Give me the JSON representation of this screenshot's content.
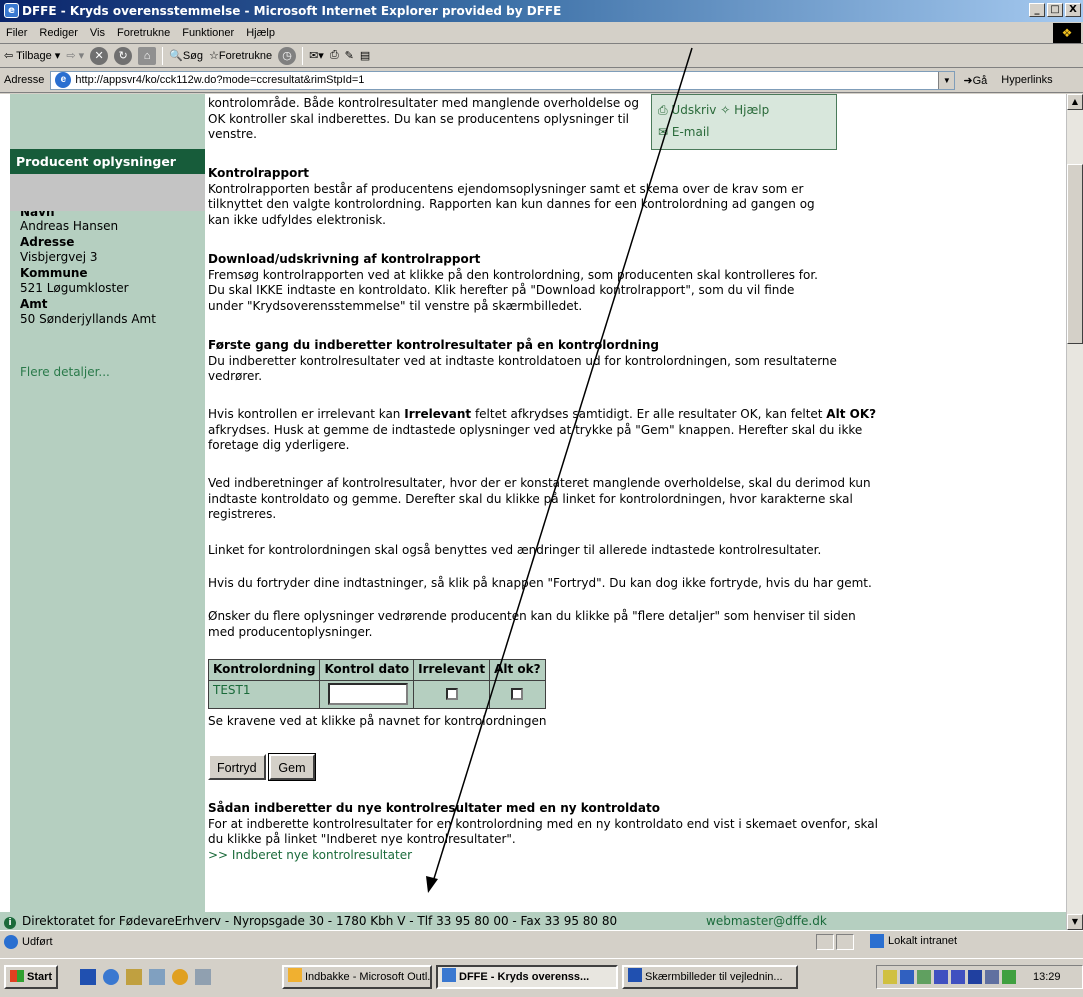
{
  "window": {
    "title": "DFFE - Kryds overensstemmelse - Microsoft Internet Explorer provided by DFFE",
    "controls": [
      "_",
      "□",
      "X"
    ]
  },
  "menubar": {
    "items": [
      "Filer",
      "Rediger",
      "Vis",
      "Foretrukne",
      "Funktioner",
      "Hjælp"
    ]
  },
  "toolbar": {
    "back_label": "Tilbage",
    "search_label": "Søg",
    "favorites_label": "Foretrukne"
  },
  "addressbar": {
    "label": "Adresse",
    "url": "http://appsvr4/ko/cck112w.do?mode=ccresultat&rimStpId=1",
    "go_label": "Gå",
    "links_label": "Hyperlinks"
  },
  "left_panel": {
    "header": "Producent oplysninger",
    "fields": [
      {
        "label": "Navn",
        "value": "Andreas Hansen"
      },
      {
        "label": "Adresse",
        "value": "Visbjergvej 3"
      },
      {
        "label": "Kommune",
        "value": "521 Løgumkloster"
      },
      {
        "label": "Amt",
        "value": "50 Sønderjyllands Amt"
      }
    ],
    "more_link": "Flere detaljer..."
  },
  "topbox": {
    "print_label": "Udskriv",
    "help_label": "Hjælp",
    "email_label": "E-mail"
  },
  "content": {
    "intro_lines": [
      "kontrolområde. Både kontrolresultater med manglende overholdelse og",
      "OK kontroller skal indberettes. Du kan se producentens oplysninger til",
      "venstre."
    ],
    "kontrolrapport_title": "Kontrolrapport",
    "kontrolrapport_lines": [
      "Kontrolrapporten består af producentens ejendomsoplysninger samt et skema over de krav som er",
      "tilknyttet den valgte kontrolordning. Rapporten kan kun dannes for een kontrolordning ad gangen og",
      "kan ikke udfyldes elektronisk."
    ],
    "download_title": "Download/udskrivning af kontrolrapport",
    "download_lines": [
      "Fremsøg kontrolrapporten ved at klikke på den kontrolordning, som producenten skal kontrolleres for.",
      "Du skal IKKE indtaste en kontroldato. Klik herefter på \"Download kontrolrapport\", som du vil finde",
      "under \"Krydsoverensstemmelse\" til venstre på skærmbilledet."
    ],
    "first_title": "Første gang du indberetter kontrolresultater på en kontrolordning",
    "first_lines": [
      "Du indberetter kontrolresultater ved at indtaste kontroldatoen ud for kontrolordningen, som resultaterne",
      "vedrører."
    ],
    "irrelevant_line1_a": "Hvis kontrollen er irrelevant kan ",
    "irrelevant_line1_b": "Irrelevant",
    "irrelevant_line1_c": " feltet afkrydses samtidigt. Er alle resultater OK, kan feltet ",
    "irrelevant_line1_d": "Alt OK?",
    "irrelevant_lines_rest": [
      "afkrydses. Husk at gemme de indtastede oplysninger ved at trykke på \"Gem\" knappen. Herefter skal du ikke",
      "foretage dig yderligere."
    ],
    "mangel_lines": [
      "Ved indberetninger af kontrolresultater, hvor der er konstateret manglende overholdelse, skal du derimod kun",
      "indtaste kontroldato og gemme. Derefter skal du klikke på linket for kontrolordningen, hvor karakterne skal",
      "registreres."
    ],
    "linket_line": "Linket for kontrolordningen skal også benyttes ved ændringer til allerede indtastede kontrolresultater.",
    "fortryd_line": "Hvis du fortryder dine indtastninger, så klik på knappen \"Fortryd\". Du kan dog ikke fortryde, hvis du har gemt.",
    "flere_lines": [
      "Ønsker du flere oplysninger vedrørende producenten kan du klikke på \"flere detaljer\" som henviser til siden",
      "med producentoplysninger."
    ],
    "table": {
      "headers": [
        "Kontrolordning",
        "Kontrol dato",
        "Irrelevant",
        "Alt ok?"
      ],
      "rows": [
        {
          "ordning": "TEST1",
          "dato": "",
          "irrelevant": false,
          "alt_ok": false
        }
      ]
    },
    "se_kravene": "Se kravene ved at klikke på navnet for kontrolordningen",
    "fortryd_button": "Fortryd",
    "gem_button": "Gem",
    "ny_title": "Sådan indberetter du nye kontrolresultater med en ny kontroldato",
    "ny_lines": [
      "For at indberette kontrolresultater for en kontrolordning med en ny kontroldato end vist i skemaet ovenfor, skal",
      "du klikke på linket \"Indberet nye kontrolresultater\"."
    ],
    "ny_link": ">> Indberet nye kontrolresultater"
  },
  "page_footer": {
    "text": "Direktoratet for FødevareErhverv - Nyropsgade 30 - 1780 Kbh V - Tlf 33 95 80 00 - Fax 33 95 80 80",
    "email": "webmaster@dffe.dk"
  },
  "ie_status": {
    "status": "Udført",
    "zone": "Lokalt intranet"
  },
  "taskbar": {
    "start": "Start",
    "tasks": [
      "Indbakke - Microsoft Outl...",
      "DFFE - Kryds overenss...",
      "Skærmbilleder til vejlednin..."
    ],
    "clock": "13:29"
  },
  "colors": {
    "panel_green": "#b5cfc0",
    "header_green": "#175c3a",
    "link_green": "#1a6a3a"
  }
}
